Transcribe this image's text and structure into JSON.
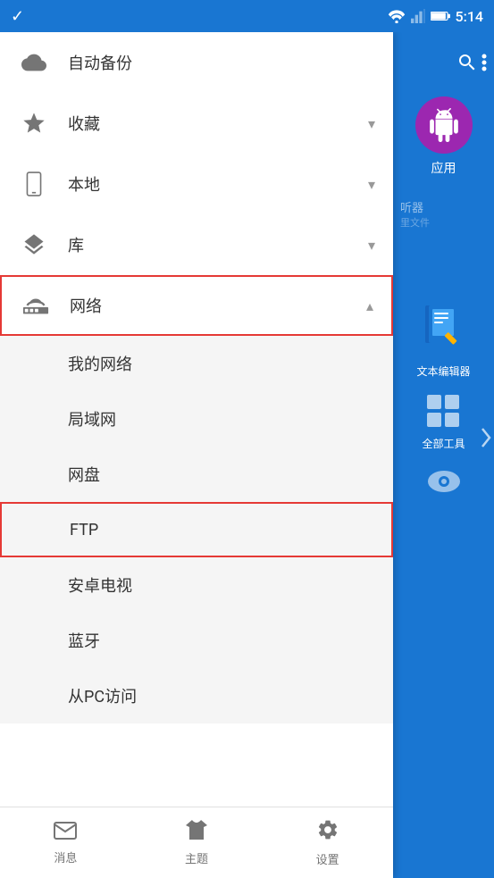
{
  "statusBar": {
    "time": "5:14"
  },
  "sidebar": {
    "items": [
      {
        "id": "auto-backup",
        "label": "自动备份",
        "icon": "cloud",
        "expandable": false,
        "active": false
      },
      {
        "id": "favorites",
        "label": "收藏",
        "icon": "star",
        "expandable": true,
        "expanded": false,
        "active": false
      },
      {
        "id": "local",
        "label": "本地",
        "icon": "phone",
        "expandable": true,
        "expanded": false,
        "active": false
      },
      {
        "id": "library",
        "label": "库",
        "icon": "layers",
        "expandable": true,
        "expanded": false,
        "active": false
      },
      {
        "id": "network",
        "label": "网络",
        "icon": "wifi",
        "expandable": true,
        "expanded": true,
        "active": true
      }
    ],
    "networkSubItems": [
      {
        "id": "my-network",
        "label": "我的网络",
        "active": false
      },
      {
        "id": "lan",
        "label": "局域网",
        "active": false
      },
      {
        "id": "cloud-disk",
        "label": "网盘",
        "active": false
      },
      {
        "id": "ftp",
        "label": "FTP",
        "active": true
      },
      {
        "id": "android-tv",
        "label": "安卓电视",
        "active": false
      },
      {
        "id": "bluetooth",
        "label": "蓝牙",
        "active": false
      },
      {
        "id": "pc-access",
        "label": "从PC访问",
        "active": false
      }
    ]
  },
  "bottomNav": [
    {
      "id": "messages",
      "label": "消息",
      "icon": "envelope"
    },
    {
      "id": "theme",
      "label": "主题",
      "icon": "tshirt"
    },
    {
      "id": "settings",
      "label": "设置",
      "icon": "gear"
    }
  ],
  "rightPanel": {
    "appLabel": "应用",
    "textEditorLabel": "文本编辑器",
    "allToolsLabel": "全部工具"
  }
}
